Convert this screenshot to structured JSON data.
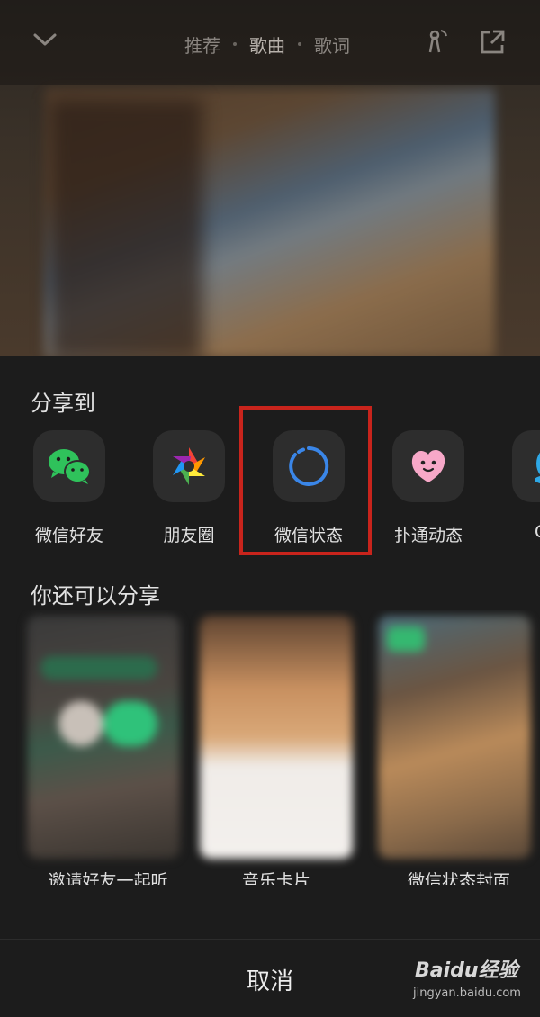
{
  "header": {
    "tabs": [
      {
        "label": "推荐"
      },
      {
        "label": "歌曲",
        "active": true
      },
      {
        "label": "歌词"
      }
    ],
    "icons": [
      "chevron-down-icon",
      "cast-icon",
      "share-icon"
    ]
  },
  "share": {
    "title": "分享到",
    "items": [
      {
        "label": "微信好友",
        "icon": "wechat-icon"
      },
      {
        "label": "朋友圈",
        "icon": "moments-icon"
      },
      {
        "label": "微信状态",
        "icon": "wechat-status-icon",
        "highlighted": true
      },
      {
        "label": "扑通动态",
        "icon": "putong-icon"
      },
      {
        "label": "QQ",
        "icon": "qq-icon"
      }
    ]
  },
  "more": {
    "title": "你还可以分享",
    "cards": [
      {
        "label": "邀请好友一起听"
      },
      {
        "label": "音乐卡片"
      },
      {
        "label": "微信状态封面"
      }
    ]
  },
  "cancel_label": "取消",
  "watermark": {
    "brand": "Baidu经验",
    "url": "jingyan.baidu.com"
  },
  "colors": {
    "highlight": "#c8241c",
    "wechat_green": "#2fc25b",
    "status_blue": "#3a86e8"
  }
}
